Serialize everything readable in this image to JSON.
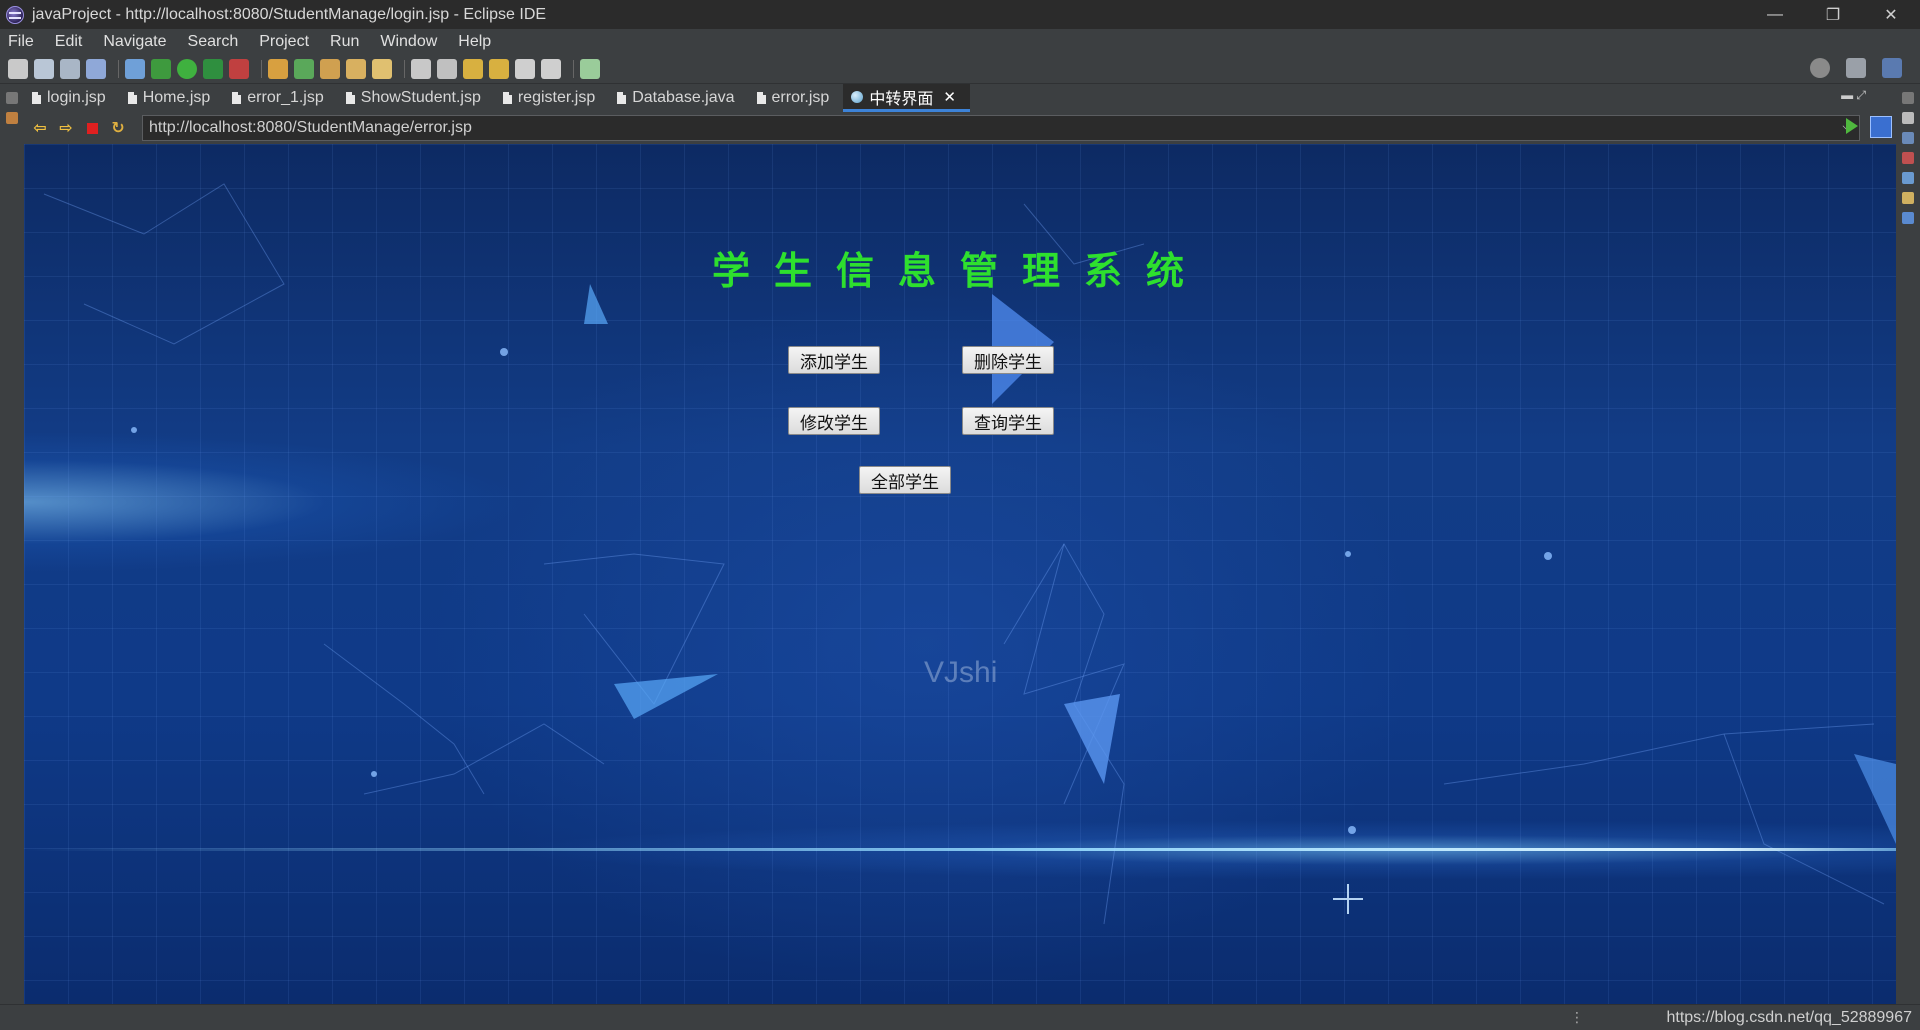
{
  "window": {
    "title": "javaProject - http://localhost:8080/StudentManage/login.jsp - Eclipse IDE",
    "controls": [
      "—",
      "❐",
      "✕"
    ]
  },
  "menu": [
    "File",
    "Edit",
    "Navigate",
    "Search",
    "Project",
    "Run",
    "Window",
    "Help"
  ],
  "tabs": [
    {
      "label": "login.jsp",
      "icon": "file-icon",
      "active": false
    },
    {
      "label": "Home.jsp",
      "icon": "file-icon",
      "active": false
    },
    {
      "label": "error_1.jsp",
      "icon": "file-icon",
      "active": false
    },
    {
      "label": "ShowStudent.jsp",
      "icon": "file-icon",
      "active": false
    },
    {
      "label": "register.jsp",
      "icon": "file-icon",
      "active": false
    },
    {
      "label": "Database.java",
      "icon": "file-icon",
      "active": false
    },
    {
      "label": "error.jsp",
      "icon": "file-icon",
      "active": false
    },
    {
      "label": "中转界面",
      "icon": "globe-icon",
      "active": true,
      "close": "✕"
    }
  ],
  "browser": {
    "url": "http://localhost:8080/StudentManage/error.jsp",
    "back": "⇦",
    "forward": "⇨",
    "refresh": "↻"
  },
  "page": {
    "title": "学生信息管理系统",
    "buttons": {
      "add": "添加学生",
      "delete": "删除学生",
      "modify": "修改学生",
      "query": "查询学生",
      "all": "全部学生"
    },
    "watermark": "VJshi"
  },
  "status": {
    "right_text": "https://blog.csdn.net/qq_52889967",
    "dots": "⋮"
  },
  "colors": {
    "title_green": "#2ee02e",
    "active_tab_underline": "#3d83d8",
    "ide_background": "#3c3f41"
  }
}
